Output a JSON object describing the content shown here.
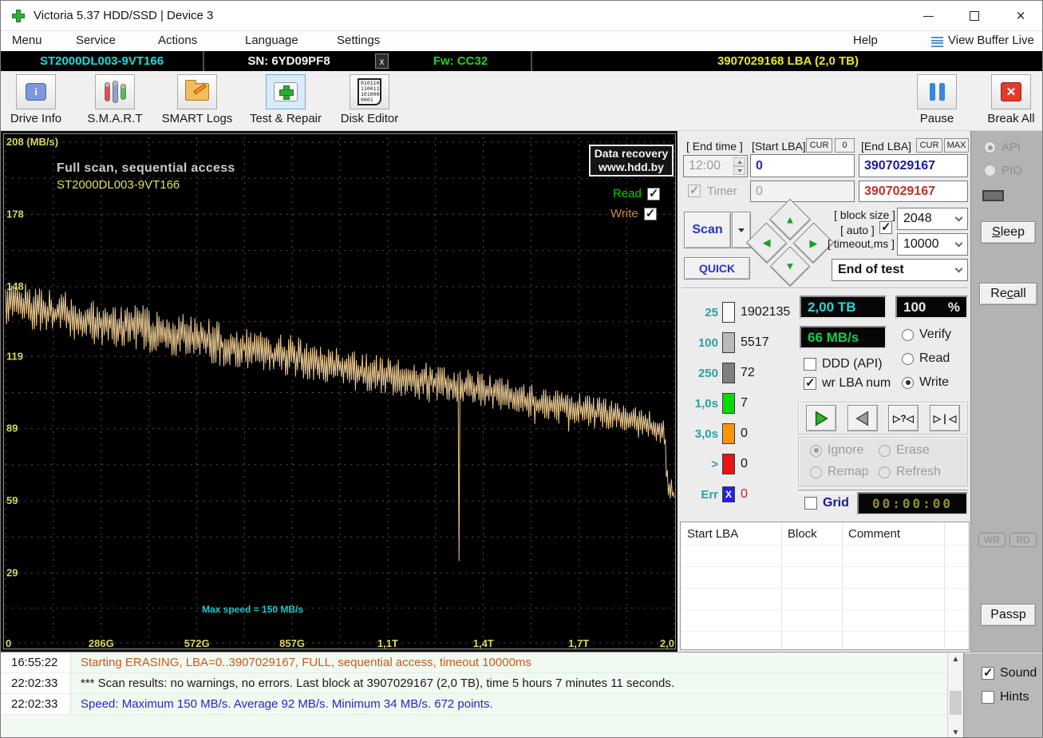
{
  "window": {
    "title": "Victoria 5.37 HDD/SSD | Device 3"
  },
  "menu": {
    "items": [
      "Menu",
      "Service",
      "Actions",
      "Language",
      "Settings"
    ],
    "help": "Help",
    "view_buffer": "View Buffer Live"
  },
  "device_bar": {
    "model": "ST2000DL003-9VT166",
    "serial": "SN: 6YD09PF8",
    "close": "x",
    "firmware": "Fw: CC32",
    "capacity": "3907029168 LBA (2,0 TB)"
  },
  "toolbar": {
    "items": [
      {
        "label": "Drive Info"
      },
      {
        "label": "S.M.A.R.T"
      },
      {
        "label": "SMART Logs"
      },
      {
        "label": "Test & Repair"
      },
      {
        "label": "Disk Editor",
        "icon_lines": [
          "010110",
          "110011",
          "101000",
          "0001"
        ]
      }
    ],
    "info_glyph": "i",
    "pause": "Pause",
    "break_all": "Break All"
  },
  "chart_data": {
    "type": "line",
    "title": "Full scan, sequential access",
    "subtitle": "ST2000DL003-9VT166",
    "ylabel": "MB/s",
    "ylim": [
      0,
      208
    ],
    "x_range_gb": [
      0,
      2000
    ],
    "grid": true,
    "points": 672,
    "line_color": "#eac891",
    "grid_color": "#535353",
    "tick_color": "#d8d85c",
    "y_ticks": [
      {
        "v": 208,
        "label": "208 (MB/s)"
      },
      {
        "v": 178,
        "label": "178"
      },
      {
        "v": 148,
        "label": "148"
      },
      {
        "v": 119,
        "label": "119"
      },
      {
        "v": 89,
        "label": "89"
      },
      {
        "v": 59,
        "label": "59"
      },
      {
        "v": 29,
        "label": "29"
      }
    ],
    "x_ticks": [
      {
        "g": 0,
        "label": "0"
      },
      {
        "g": 286,
        "label": "286G"
      },
      {
        "g": 572,
        "label": "572G"
      },
      {
        "g": 857,
        "label": "857G"
      },
      {
        "g": 1143,
        "label": "1,1T"
      },
      {
        "g": 1429,
        "label": "1,4T"
      },
      {
        "g": 1714,
        "label": "1,7T"
      },
      {
        "g": 2000,
        "label": "2,0"
      }
    ],
    "legend": [
      {
        "label": "Read",
        "checked": true
      },
      {
        "label": "Write",
        "checked": true
      }
    ],
    "watermark": {
      "line1": "Data recovery",
      "line2": "www.hdd.by"
    },
    "annotation": "Max speed = 150 MB/s",
    "stats": {
      "max_mbs": 150,
      "avg_mbs": 92,
      "min_mbs": 34
    },
    "trend": [
      [
        0,
        143
      ],
      [
        60,
        139
      ],
      [
        150,
        137
      ],
      [
        290,
        133
      ],
      [
        400,
        131
      ],
      [
        500,
        128
      ],
      [
        572,
        127
      ],
      [
        650,
        124
      ],
      [
        750,
        122
      ],
      [
        857,
        119
      ],
      [
        950,
        116
      ],
      [
        1050,
        113
      ],
      [
        1143,
        111
      ],
      [
        1250,
        109
      ],
      [
        1340,
        107
      ],
      [
        1420,
        105
      ],
      [
        1500,
        103
      ],
      [
        1600,
        99
      ],
      [
        1714,
        97
      ],
      [
        1800,
        95
      ],
      [
        1900,
        91
      ],
      [
        1955,
        89
      ],
      [
        1970,
        88
      ],
      [
        1980,
        66
      ],
      [
        1990,
        62
      ],
      [
        2000,
        64
      ]
    ],
    "down_spikes": [
      [
        1356,
        34
      ]
    ],
    "noise_amp": 9
  },
  "scan_controls": {
    "end_time_label": "[ End time ]",
    "end_time": "12:00",
    "start_lba_label": "[Start LBA]",
    "cur": "CUR",
    "zero": "0",
    "end_lba_label": "[End LBA]",
    "max": "MAX",
    "start_lba": "0",
    "end_lba": "3907029167",
    "end_lba_passes": "3907029167",
    "timer_label": "Timer",
    "timer_value": "0",
    "scan": "Scan",
    "quick": "QUICK",
    "block_size_label": "[ block size ]",
    "auto_label": "[ auto ]",
    "block_size": "2048",
    "timeout_label": "[ timeout,ms ]",
    "timeout": "10000",
    "end_of_test": "End of test"
  },
  "counters": {
    "rows": [
      {
        "label": "25",
        "color": "#fafafa",
        "value": "1902135"
      },
      {
        "label": "100",
        "color": "#b9b9b9",
        "value": "5517"
      },
      {
        "label": "250",
        "color": "#7f7f7f",
        "value": "72"
      },
      {
        "label": "1,0s",
        "color": "#00dd00",
        "value": "7"
      },
      {
        "label": "3,0s",
        "color": "#ff9500",
        "value": "0"
      },
      {
        "label": ">",
        "color": "#ee1111",
        "value": "0"
      },
      {
        "label": "Err",
        "color": "#2222ee",
        "value": "0",
        "x_mark": "X",
        "value_color": "#cc2222"
      }
    ]
  },
  "status": {
    "capacity": "2,00 TB",
    "percent": "100",
    "percent_sign": "%",
    "speed": "66 MB/s",
    "capacity_color": "#23d9d9",
    "percent_color": "#eaeaea",
    "speed_color": "#17cc44"
  },
  "mode": {
    "options": [
      "Verify",
      "Read",
      "Write"
    ],
    "selected": "Write",
    "ddd": "DDD (API)",
    "wr_lba": "wr LBA num"
  },
  "defect_actions": {
    "options": [
      "Ignore",
      "Erase",
      "Remap",
      "Refresh"
    ],
    "selected": "Ignore"
  },
  "grid_box": {
    "label": "Grid",
    "timer": "00:00:00"
  },
  "defect_table": {
    "headers": [
      "Start LBA",
      "Block",
      "Comment"
    ]
  },
  "side": {
    "api": "API",
    "pio": "PIO",
    "sleep": {
      "text": "Sleep",
      "accel": 0
    },
    "recall": {
      "text": "Recall",
      "accel": 2
    },
    "wr": "WR",
    "rd": "RD",
    "passp": {
      "text": "Passp",
      "accel": -1
    }
  },
  "log": {
    "entries": [
      {
        "time": "16:55:22",
        "text": "Starting ERASING, LBA=0..3907029167, FULL, sequential access, timeout 10000ms",
        "color": "#c75a1e"
      },
      {
        "time": "22:02:33",
        "text": "*** Scan results: no warnings, no errors. Last block at 3907029167 (2,0 TB), time 5 hours 7 minutes 11 seconds.",
        "color": "#1a1a1a"
      },
      {
        "time": "22:02:33",
        "text": "Speed: Maximum 150 MB/s. Average 92 MB/s. Minimum 34 MB/s. 672 points.",
        "color": "#2626cc"
      }
    ]
  },
  "footer": {
    "sound": "Sound",
    "hints": "Hints"
  }
}
